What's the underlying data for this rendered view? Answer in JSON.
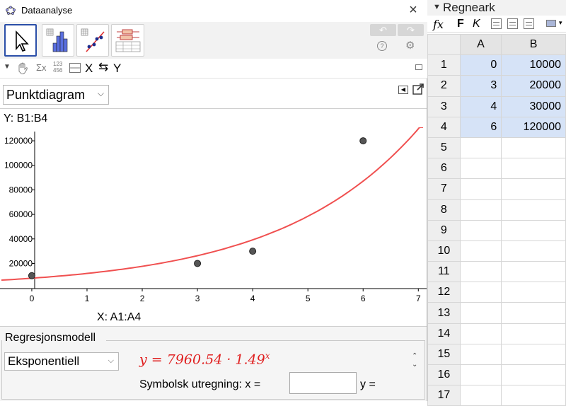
{
  "window": {
    "title": "Dataanalyse",
    "close_glyph": "×"
  },
  "toolbar": {
    "tools": [
      {
        "name": "select-tool",
        "icon": "cursor-arrow-icon",
        "active": true
      },
      {
        "name": "histogram-tool",
        "icon": "histogram-icon",
        "active": false
      },
      {
        "name": "scatter-tool",
        "icon": "scatter-regression-icon",
        "active": false
      },
      {
        "name": "boxplot-tool",
        "icon": "multi-boxplot-icon",
        "active": false
      }
    ],
    "undo_glyph": "↶",
    "redo_glyph": "↷",
    "help_glyph": "?",
    "settings_glyph": "⚙"
  },
  "subbar": {
    "sigma_label": "Σx",
    "digits_top": "123",
    "digits_bottom": "456",
    "swap_x": "X",
    "swap_arrows": "⇆",
    "swap_y": "Y"
  },
  "plot_panel": {
    "chart_type": "Punktdiagram",
    "y_caption": "Y:  B1:B4",
    "x_caption": "X:  A1:A4"
  },
  "chart_data": {
    "type": "scatter",
    "x": [
      0,
      3,
      4,
      6
    ],
    "y": [
      10000,
      20000,
      30000,
      120000
    ],
    "xlim": [
      -0.55,
      7.15
    ],
    "ylim": [
      -500,
      131000
    ],
    "xticks": [
      0,
      1,
      2,
      3,
      4,
      5,
      6,
      7
    ],
    "yticks": [
      20000,
      40000,
      60000,
      80000,
      100000,
      120000
    ],
    "regression": {
      "model": "exponential",
      "a": 7960.54,
      "b": 1.49
    },
    "point_color": "#555555",
    "curve_color": "#f05050"
  },
  "regression": {
    "section_title": "Regresjonsmodell",
    "model": "Eksponentiell",
    "formula": "y = 7960.54 · 1.49",
    "formula_exp": "x",
    "symbolic_label": "Symbolsk utregning:  x =",
    "symbolic_value": "",
    "y_label": "y ="
  },
  "sheet": {
    "title": "Regneark",
    "fx": "fx",
    "bold": "F",
    "italic": "K",
    "columns": [
      "A",
      "B"
    ],
    "rows": [
      {
        "n": "1",
        "a": "0",
        "b": "10000"
      },
      {
        "n": "2",
        "a": "3",
        "b": "20000"
      },
      {
        "n": "3",
        "a": "4",
        "b": "30000"
      },
      {
        "n": "4",
        "a": "6",
        "b": "120000"
      },
      {
        "n": "5",
        "a": "",
        "b": ""
      },
      {
        "n": "6",
        "a": "",
        "b": ""
      },
      {
        "n": "7",
        "a": "",
        "b": ""
      },
      {
        "n": "8",
        "a": "",
        "b": ""
      },
      {
        "n": "9",
        "a": "",
        "b": ""
      },
      {
        "n": "10",
        "a": "",
        "b": ""
      },
      {
        "n": "11",
        "a": "",
        "b": ""
      },
      {
        "n": "12",
        "a": "",
        "b": ""
      },
      {
        "n": "13",
        "a": "",
        "b": ""
      },
      {
        "n": "14",
        "a": "",
        "b": ""
      },
      {
        "n": "15",
        "a": "",
        "b": ""
      },
      {
        "n": "16",
        "a": "",
        "b": ""
      },
      {
        "n": "17",
        "a": "",
        "b": ""
      }
    ]
  }
}
